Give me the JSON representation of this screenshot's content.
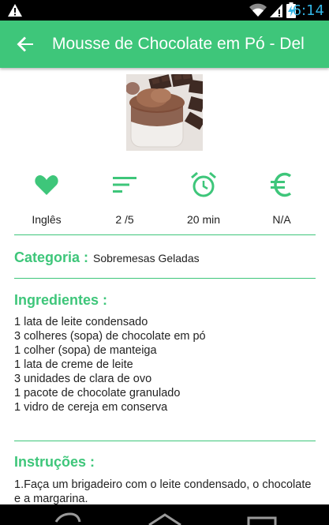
{
  "status_bar": {
    "time": "6:14",
    "icons": [
      "warning-icon",
      "wifi-icon",
      "signal-icon",
      "battery-charging-icon"
    ]
  },
  "app_bar": {
    "title": "Mousse de Chocolate em Pó - Del",
    "back_icon": "arrow-back-icon"
  },
  "recipe": {
    "image": "chocolate-mousse-photo",
    "stats": [
      {
        "icon": "heart-icon",
        "label": "Inglês"
      },
      {
        "icon": "sort-difficulty-icon",
        "label": "2 /5"
      },
      {
        "icon": "alarm-clock-icon",
        "label": "20 min"
      },
      {
        "icon": "euro-icon",
        "label": "N/A"
      }
    ],
    "category": {
      "title": "Categoria :",
      "value": "Sobremesas Geladas"
    },
    "ingredients": {
      "title": "Ingredientes :",
      "items": [
        "1 lata de leite condensado",
        "3 colheres (sopa) de chocolate em pó",
        "1 colher (sopa) de manteiga",
        "1 lata de creme de leite",
        "3 unidades de clara de ovo",
        "1 pacote de chocolate granulado",
        "1 vidro de cereja em conserva"
      ]
    },
    "instructions": {
      "title": "Instruções :",
      "text": "1.Faça um brigadeiro com o leite condensado, o chocolate e a margarina."
    }
  },
  "colors": {
    "accent": "#3ec67a",
    "status_clock": "#33b5e5"
  },
  "nav_bar": {
    "icons": [
      "back-nav-icon",
      "home-nav-icon",
      "recents-nav-icon"
    ]
  }
}
